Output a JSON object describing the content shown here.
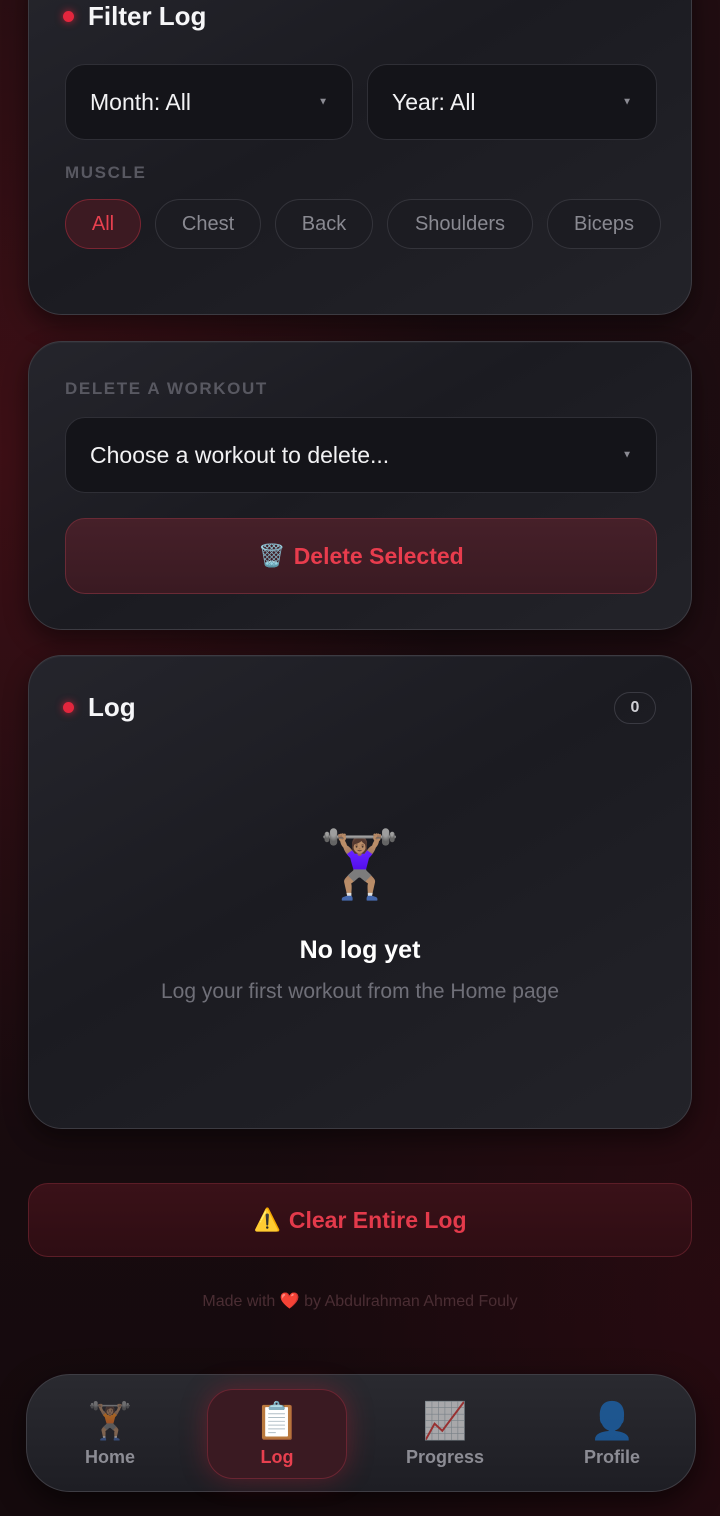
{
  "filter": {
    "title": "Filter Log",
    "month_select": "Month: All",
    "year_select": "Year: All",
    "muscle_label": "MUSCLE",
    "muscle_chips": [
      "All",
      "Chest",
      "Back",
      "Shoulders",
      "Biceps"
    ],
    "active_chip": "All"
  },
  "delete": {
    "label": "DELETE A WORKOUT",
    "select_placeholder": "Choose a workout to delete...",
    "button_icon": "🗑️",
    "button_label": "Delete Selected"
  },
  "log": {
    "title": "Log",
    "count": "0",
    "empty_icon": "🏋🏽‍♀️",
    "empty_title": "No log yet",
    "empty_subtitle": "Log your first workout from the Home page"
  },
  "clear": {
    "icon": "⚠️",
    "label": "Clear Entire Log"
  },
  "footer": {
    "prefix": "Made with",
    "heart": "❤️",
    "suffix": "by Abdulrahman Ahmed Fouly"
  },
  "nav": {
    "items": [
      {
        "label": "Home",
        "icon": "🏋🏽"
      },
      {
        "label": "Log",
        "icon": "📋"
      },
      {
        "label": "Progress",
        "icon": "📈"
      },
      {
        "label": "Profile",
        "icon": "👤"
      }
    ],
    "active": "Log"
  },
  "colors": {
    "accent": "#e3263d",
    "background": "#1a0c10",
    "card": "#1f1f25"
  }
}
